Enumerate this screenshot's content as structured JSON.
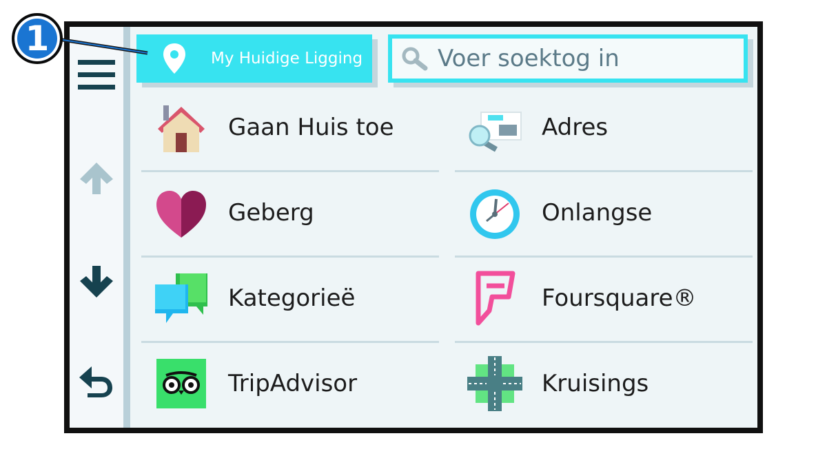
{
  "callout": {
    "number": "1"
  },
  "topbar": {
    "location_button": {
      "label": "My Huidige Ligging",
      "icon": "map-pin-icon"
    },
    "search": {
      "placeholder": "Voer soektog in",
      "icon": "magnifier-icon"
    }
  },
  "sidebar": {
    "buttons": [
      {
        "icon": "hamburger-menu-icon"
      },
      {
        "icon": "arrow-up-icon"
      },
      {
        "icon": "arrow-down-icon"
      },
      {
        "icon": "back-arrow-icon"
      }
    ]
  },
  "categories": [
    {
      "label": "Gaan Huis toe",
      "icon": "house-icon"
    },
    {
      "label": "Adres",
      "icon": "address-card-search-icon"
    },
    {
      "label": "Geberg",
      "icon": "heart-icon"
    },
    {
      "label": "Onlangse",
      "icon": "clock-icon"
    },
    {
      "label": "Kategorieë",
      "icon": "speech-bubbles-icon"
    },
    {
      "label": "Foursquare®",
      "icon": "foursquare-logo-icon"
    },
    {
      "label": "TripAdvisor",
      "icon": "tripadvisor-owl-icon"
    },
    {
      "label": "Kruisings",
      "icon": "intersection-icon"
    }
  ],
  "colors": {
    "accent": "#37e3f0",
    "callout": "#1a75d2",
    "panel": "#eef5f7",
    "sidebar_border": "#b9d0d9",
    "text": "#1c1c1c"
  }
}
